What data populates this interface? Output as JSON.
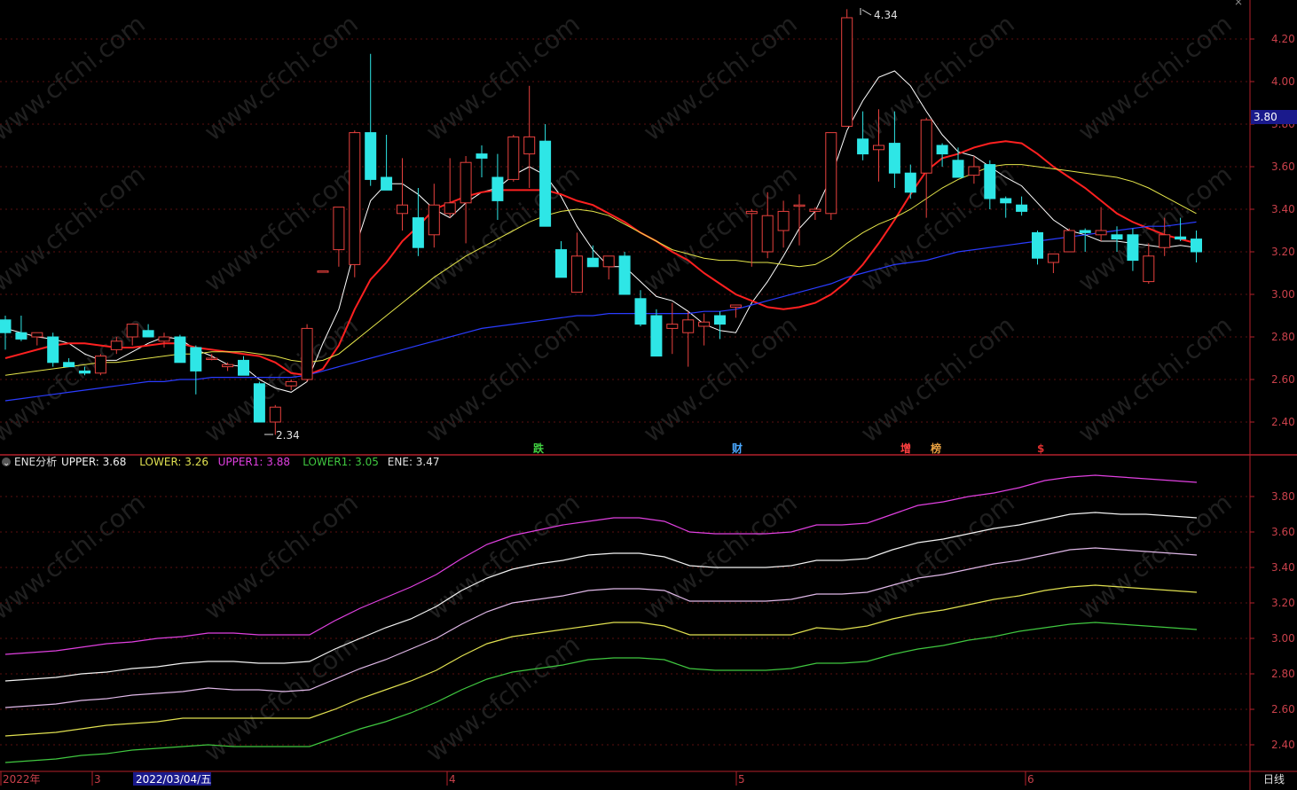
{
  "header": {
    "close_glyph": "×"
  },
  "colors": {
    "background": "#000000",
    "axis_red": "#b3202a",
    "tick_text": "#c8404a",
    "up_candle": "#e8413e",
    "down_candle": "#2ee6e6",
    "ma5": "#ffffff",
    "ma10": "#ff2020",
    "ma20": "#e5e54a",
    "ma60": "#2a3cff",
    "upper1": "#e040e0",
    "upper": "#f2f2f2",
    "ene": "#e0b8e8",
    "lower": "#e0e050",
    "lower1": "#40c840"
  },
  "price_axis": {
    "ticks": [
      "4.20",
      "4.00",
      "3.80",
      "3.60",
      "3.40",
      "3.20",
      "3.00",
      "2.80",
      "2.60",
      "2.40"
    ],
    "current_price_badge": "3.80"
  },
  "ene_axis": {
    "ticks": [
      "3.80",
      "3.60",
      "3.40",
      "3.20",
      "3.00",
      "2.80",
      "2.60",
      "2.40"
    ]
  },
  "annotations": {
    "high_label": "4.34",
    "low_label": "2.34",
    "events": [
      {
        "text": "跌",
        "color": "#40d040"
      },
      {
        "text": "财",
        "color": "#4aa8ff"
      },
      {
        "text": "增",
        "color": "#ff4040"
      },
      {
        "text": "榜",
        "color": "#e8a040"
      },
      {
        "text": "$",
        "color": "#e03030"
      }
    ]
  },
  "indicator_legend": {
    "toggle_glyph": "⌄",
    "name": "ENE分析",
    "items": [
      {
        "label": "UPPER: 3.68",
        "color": "#f2f2f2"
      },
      {
        "label": "LOWER: 3.26",
        "color": "#e0e050"
      },
      {
        "label": "UPPER1: 3.88",
        "color": "#e040e0"
      },
      {
        "label": "LOWER1: 3.05",
        "color": "#40c840"
      },
      {
        "label": "ENE: 3.47",
        "color": "#e0e0e0"
      }
    ]
  },
  "time_axis": {
    "labels": [
      "2022年",
      "3",
      "4",
      "5",
      "6"
    ],
    "cursor_date": "2022/03/04/五",
    "period_label": "日线"
  },
  "watermark": "www.cfchi.com",
  "chart_data": [
    {
      "type": "candlestick",
      "title": "",
      "ylim": [
        2.3,
        4.35
      ],
      "ohlc": [
        [
          2.88,
          2.9,
          2.74,
          2.82
        ],
        [
          2.82,
          2.9,
          2.78,
          2.79
        ],
        [
          2.8,
          2.82,
          2.76,
          2.82
        ],
        [
          2.8,
          2.82,
          2.66,
          2.68
        ],
        [
          2.68,
          2.7,
          2.66,
          2.66
        ],
        [
          2.64,
          2.66,
          2.62,
          2.63
        ],
        [
          2.63,
          2.72,
          2.62,
          2.71
        ],
        [
          2.74,
          2.8,
          2.72,
          2.78
        ],
        [
          2.8,
          2.86,
          2.76,
          2.86
        ],
        [
          2.83,
          2.86,
          2.8,
          2.8
        ],
        [
          2.78,
          2.82,
          2.75,
          2.8
        ],
        [
          2.8,
          2.81,
          2.68,
          2.68
        ],
        [
          2.75,
          2.76,
          2.53,
          2.64
        ],
        [
          2.7,
          2.72,
          2.69,
          2.7
        ],
        [
          2.66,
          2.68,
          2.64,
          2.67
        ],
        [
          2.69,
          2.71,
          2.62,
          2.62
        ],
        [
          2.58,
          2.59,
          2.4,
          2.4
        ],
        [
          2.4,
          2.48,
          2.34,
          2.47
        ],
        [
          2.57,
          2.6,
          2.55,
          2.59
        ],
        [
          2.6,
          2.86,
          2.59,
          2.84
        ],
        [
          3.11,
          3.11,
          3.11,
          3.11
        ],
        [
          3.21,
          3.41,
          3.13,
          3.41
        ],
        [
          3.14,
          3.77,
          3.08,
          3.76
        ],
        [
          3.76,
          4.13,
          3.51,
          3.54
        ],
        [
          3.55,
          3.75,
          3.5,
          3.49
        ],
        [
          3.38,
          3.64,
          3.3,
          3.42
        ],
        [
          3.36,
          3.5,
          3.18,
          3.22
        ],
        [
          3.28,
          3.52,
          3.22,
          3.42
        ],
        [
          3.38,
          3.64,
          3.36,
          3.43
        ],
        [
          3.43,
          3.65,
          3.24,
          3.62
        ],
        [
          3.66,
          3.7,
          3.55,
          3.64
        ],
        [
          3.55,
          3.66,
          3.35,
          3.44
        ],
        [
          3.54,
          3.75,
          3.53,
          3.74
        ],
        [
          3.66,
          3.98,
          3.5,
          3.74
        ],
        [
          3.72,
          3.8,
          3.34,
          3.32
        ],
        [
          3.21,
          3.25,
          3.15,
          3.08
        ],
        [
          3.01,
          3.29,
          3.01,
          3.18
        ],
        [
          3.17,
          3.23,
          3.13,
          3.13
        ],
        [
          3.13,
          3.16,
          3.07,
          3.18
        ],
        [
          3.18,
          3.2,
          3.08,
          3.0
        ],
        [
          2.98,
          3.02,
          2.85,
          2.86
        ],
        [
          2.9,
          2.93,
          2.77,
          2.71
        ],
        [
          2.84,
          2.96,
          2.72,
          2.86
        ],
        [
          2.82,
          2.92,
          2.66,
          2.88
        ],
        [
          2.85,
          2.91,
          2.76,
          2.87
        ],
        [
          2.9,
          2.92,
          2.79,
          2.86
        ],
        [
          2.94,
          2.94,
          2.89,
          2.95
        ],
        [
          3.38,
          3.4,
          3.13,
          3.39
        ],
        [
          3.2,
          3.48,
          3.17,
          3.37
        ],
        [
          3.3,
          3.44,
          3.22,
          3.39
        ],
        [
          3.42,
          3.47,
          3.23,
          3.42
        ],
        [
          3.39,
          3.41,
          3.35,
          3.4
        ],
        [
          3.38,
          3.68,
          3.35,
          3.76
        ],
        [
          3.79,
          4.34,
          3.79,
          4.3
        ],
        [
          3.73,
          3.86,
          3.63,
          3.66
        ],
        [
          3.68,
          3.87,
          3.53,
          3.7
        ],
        [
          3.71,
          3.86,
          3.5,
          3.57
        ],
        [
          3.57,
          3.61,
          3.45,
          3.48
        ],
        [
          3.57,
          3.83,
          3.36,
          3.82
        ],
        [
          3.7,
          3.71,
          3.6,
          3.66
        ],
        [
          3.63,
          3.69,
          3.6,
          3.55
        ],
        [
          3.56,
          3.65,
          3.52,
          3.6
        ],
        [
          3.61,
          3.63,
          3.4,
          3.45
        ],
        [
          3.45,
          3.46,
          3.36,
          3.43
        ],
        [
          3.42,
          3.46,
          3.37,
          3.39
        ],
        [
          3.29,
          3.3,
          3.14,
          3.17
        ],
        [
          3.15,
          3.19,
          3.1,
          3.19
        ],
        [
          3.2,
          3.31,
          3.2,
          3.3
        ],
        [
          3.3,
          3.31,
          3.2,
          3.29
        ],
        [
          3.28,
          3.41,
          3.25,
          3.3
        ],
        [
          3.28,
          3.32,
          3.2,
          3.26
        ],
        [
          3.28,
          3.31,
          3.11,
          3.16
        ],
        [
          3.06,
          3.24,
          3.05,
          3.18
        ],
        [
          3.22,
          3.36,
          3.18,
          3.28
        ],
        [
          3.27,
          3.36,
          3.25,
          3.26
        ],
        [
          3.26,
          3.3,
          3.15,
          3.2
        ]
      ],
      "series": [
        {
          "values": [
            2.84,
            2.82,
            2.8,
            2.79,
            2.77,
            2.72,
            2.69,
            2.69,
            2.73,
            2.77,
            2.8,
            2.79,
            2.74,
            2.71,
            2.67,
            2.66,
            2.6,
            2.56,
            2.54,
            2.59,
            2.77,
            2.93,
            3.21,
            3.44,
            3.52,
            3.52,
            3.47,
            3.4,
            3.36,
            3.43,
            3.48,
            3.5,
            3.56,
            3.6,
            3.56,
            3.46,
            3.32,
            3.21,
            3.13,
            3.13,
            3.06,
            2.99,
            2.97,
            2.92,
            2.86,
            2.83,
            2.82,
            2.96,
            3.06,
            3.18,
            3.31,
            3.39,
            3.55,
            3.77,
            3.91,
            4.02,
            4.05,
            3.98,
            3.86,
            3.75,
            3.67,
            3.65,
            3.6,
            3.55,
            3.51,
            3.43,
            3.35,
            3.3,
            3.28,
            3.25,
            3.25,
            3.24,
            3.23,
            3.22,
            3.23,
            3.22
          ]
        },
        {
          "values": [
            2.7,
            2.72,
            2.74,
            2.76,
            2.77,
            2.77,
            2.76,
            2.75,
            2.75,
            2.76,
            2.77,
            2.77,
            2.75,
            2.74,
            2.73,
            2.72,
            2.71,
            2.68,
            2.63,
            2.62,
            2.65,
            2.76,
            2.93,
            3.07,
            3.15,
            3.25,
            3.32,
            3.4,
            3.43,
            3.46,
            3.48,
            3.49,
            3.49,
            3.49,
            3.49,
            3.47,
            3.44,
            3.42,
            3.38,
            3.34,
            3.29,
            3.25,
            3.2,
            3.16,
            3.1,
            3.05,
            3.0,
            2.97,
            2.94,
            2.93,
            2.94,
            2.96,
            3.0,
            3.06,
            3.14,
            3.24,
            3.35,
            3.47,
            3.58,
            3.64,
            3.66,
            3.69,
            3.71,
            3.72,
            3.71,
            3.66,
            3.6,
            3.55,
            3.5,
            3.44,
            3.38,
            3.34,
            3.31,
            3.28,
            3.26,
            3.24
          ]
        },
        {
          "values": [
            2.62,
            2.63,
            2.64,
            2.65,
            2.66,
            2.67,
            2.68,
            2.68,
            2.69,
            2.7,
            2.71,
            2.72,
            2.72,
            2.73,
            2.73,
            2.73,
            2.72,
            2.71,
            2.69,
            2.68,
            2.69,
            2.72,
            2.78,
            2.84,
            2.9,
            2.96,
            3.02,
            3.08,
            3.13,
            3.18,
            3.22,
            3.26,
            3.3,
            3.34,
            3.37,
            3.39,
            3.4,
            3.39,
            3.37,
            3.33,
            3.29,
            3.25,
            3.21,
            3.19,
            3.17,
            3.16,
            3.16,
            3.15,
            3.15,
            3.14,
            3.13,
            3.14,
            3.18,
            3.24,
            3.29,
            3.33,
            3.36,
            3.4,
            3.45,
            3.5,
            3.54,
            3.57,
            3.6,
            3.61,
            3.61,
            3.6,
            3.59,
            3.58,
            3.57,
            3.56,
            3.55,
            3.53,
            3.5,
            3.46,
            3.42,
            3.38
          ]
        },
        {
          "values": [
            2.5,
            2.51,
            2.52,
            2.53,
            2.54,
            2.55,
            2.56,
            2.57,
            2.58,
            2.59,
            2.59,
            2.6,
            2.6,
            2.61,
            2.61,
            2.61,
            2.61,
            2.61,
            2.61,
            2.62,
            2.64,
            2.66,
            2.68,
            2.7,
            2.72,
            2.74,
            2.76,
            2.78,
            2.8,
            2.82,
            2.84,
            2.85,
            2.86,
            2.87,
            2.88,
            2.89,
            2.9,
            2.9,
            2.91,
            2.91,
            2.91,
            2.91,
            2.91,
            2.91,
            2.92,
            2.92,
            2.93,
            2.95,
            2.97,
            2.99,
            3.01,
            3.03,
            3.05,
            3.08,
            3.1,
            3.12,
            3.14,
            3.15,
            3.16,
            3.18,
            3.2,
            3.21,
            3.22,
            3.23,
            3.24,
            3.25,
            3.26,
            3.27,
            3.28,
            3.29,
            3.3,
            3.31,
            3.32,
            3.32,
            3.33,
            3.34
          ]
        }
      ]
    },
    {
      "type": "line",
      "title": "ENE分析",
      "ylim": [
        2.3,
        3.95
      ],
      "series": [
        {
          "name": "UPPER1",
          "values": [
            2.91,
            2.92,
            2.93,
            2.95,
            2.97,
            2.98,
            3.0,
            3.01,
            3.03,
            3.03,
            3.02,
            3.02,
            3.02,
            3.1,
            3.17,
            3.23,
            3.29,
            3.36,
            3.45,
            3.53,
            3.58,
            3.61,
            3.64,
            3.66,
            3.68,
            3.68,
            3.66,
            3.6,
            3.59,
            3.59,
            3.59,
            3.6,
            3.64,
            3.64,
            3.65,
            3.7,
            3.75,
            3.77,
            3.8,
            3.82,
            3.85,
            3.89,
            3.91,
            3.92,
            3.91,
            3.9,
            3.89,
            3.88
          ]
        },
        {
          "name": "UPPER",
          "values": [
            2.76,
            2.77,
            2.78,
            2.8,
            2.81,
            2.83,
            2.84,
            2.86,
            2.87,
            2.87,
            2.86,
            2.86,
            2.87,
            2.94,
            3.0,
            3.06,
            3.11,
            3.18,
            3.27,
            3.34,
            3.39,
            3.42,
            3.44,
            3.47,
            3.48,
            3.48,
            3.46,
            3.41,
            3.4,
            3.4,
            3.4,
            3.41,
            3.44,
            3.44,
            3.45,
            3.5,
            3.54,
            3.56,
            3.59,
            3.62,
            3.64,
            3.67,
            3.7,
            3.71,
            3.7,
            3.7,
            3.69,
            3.68
          ]
        },
        {
          "name": "ENE",
          "values": [
            2.61,
            2.62,
            2.63,
            2.65,
            2.66,
            2.68,
            2.69,
            2.7,
            2.72,
            2.71,
            2.71,
            2.7,
            2.71,
            2.77,
            2.83,
            2.88,
            2.94,
            3.0,
            3.08,
            3.15,
            3.2,
            3.22,
            3.24,
            3.27,
            3.28,
            3.28,
            3.27,
            3.21,
            3.21,
            3.21,
            3.21,
            3.22,
            3.25,
            3.25,
            3.26,
            3.3,
            3.34,
            3.36,
            3.39,
            3.42,
            3.44,
            3.47,
            3.5,
            3.51,
            3.5,
            3.49,
            3.48,
            3.47
          ]
        },
        {
          "name": "LOWER",
          "values": [
            2.45,
            2.46,
            2.47,
            2.49,
            2.51,
            2.52,
            2.53,
            2.55,
            2.55,
            2.55,
            2.55,
            2.55,
            2.55,
            2.6,
            2.66,
            2.71,
            2.76,
            2.82,
            2.9,
            2.97,
            3.01,
            3.03,
            3.05,
            3.07,
            3.09,
            3.09,
            3.07,
            3.02,
            3.02,
            3.02,
            3.02,
            3.02,
            3.06,
            3.05,
            3.07,
            3.11,
            3.14,
            3.16,
            3.19,
            3.22,
            3.24,
            3.27,
            3.29,
            3.3,
            3.29,
            3.28,
            3.27,
            3.26
          ]
        },
        {
          "name": "LOWER1",
          "values": [
            2.3,
            2.31,
            2.32,
            2.34,
            2.35,
            2.37,
            2.38,
            2.39,
            2.4,
            2.39,
            2.39,
            2.39,
            2.39,
            2.44,
            2.49,
            2.53,
            2.58,
            2.64,
            2.71,
            2.77,
            2.81,
            2.83,
            2.85,
            2.88,
            2.89,
            2.89,
            2.88,
            2.83,
            2.82,
            2.82,
            2.82,
            2.83,
            2.86,
            2.86,
            2.87,
            2.91,
            2.94,
            2.96,
            2.99,
            3.01,
            3.04,
            3.06,
            3.08,
            3.09,
            3.08,
            3.07,
            3.06,
            3.05
          ]
        }
      ]
    }
  ]
}
